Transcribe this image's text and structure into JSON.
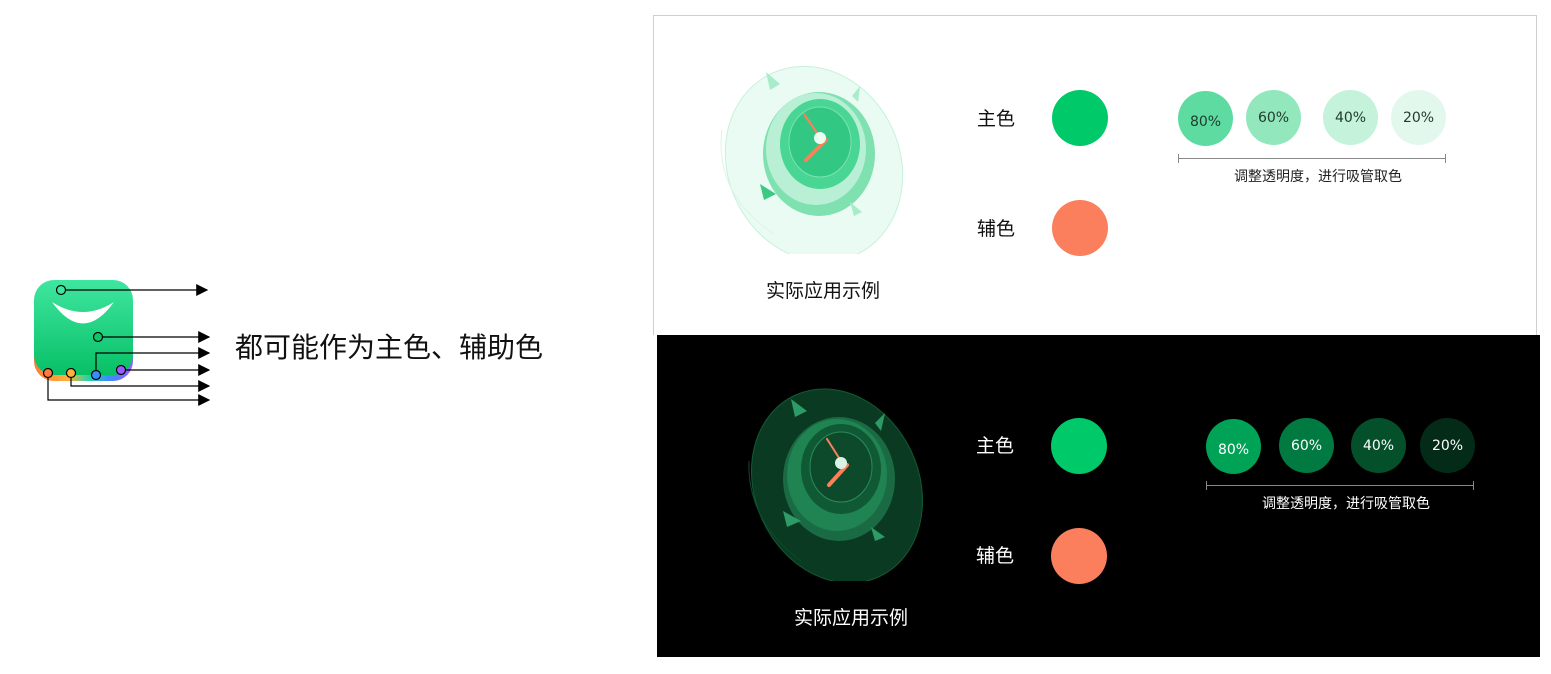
{
  "left": {
    "caption": "都可能作为主色、辅助色"
  },
  "light_panel": {
    "example_caption": "实际应用示例",
    "primary_label": "主色",
    "secondary_label": "辅色",
    "primary_color": "#00c96a",
    "secondary_color": "#fb7f5c",
    "opacity_chips": [
      {
        "label": "80%",
        "color": "#5edba0"
      },
      {
        "label": "60%",
        "color": "#92e7bd"
      },
      {
        "label": "40%",
        "color": "#c4f2da"
      },
      {
        "label": "20%",
        "color": "#e3f8ed"
      }
    ],
    "range_caption": "调整透明度，进行吸管取色"
  },
  "dark_panel": {
    "example_caption": "实际应用示例",
    "primary_label": "主色",
    "secondary_label": "辅色",
    "primary_color": "#00c96a",
    "secondary_color": "#fb7f5c",
    "opacity_chips": [
      {
        "label": "80%",
        "color": "#00a356"
      },
      {
        "label": "60%",
        "color": "#007a40"
      },
      {
        "label": "40%",
        "color": "#04502b"
      },
      {
        "label": "20%",
        "color": "#042b17"
      }
    ],
    "range_caption": "调整透明度，进行吸管取色"
  },
  "colors": {
    "icon_green_top": "#35e39a",
    "icon_green_bottom": "#05c063",
    "accent_green": "#00c96a",
    "accent_coral": "#fb7f5c",
    "icon_orange": "#ff8a3d",
    "icon_blue": "#3a8dff",
    "icon_purple": "#9b5bff"
  },
  "icons": {
    "app_icon": "shopping-bag-app-icon",
    "illustration": "compass-clock-illustration"
  }
}
